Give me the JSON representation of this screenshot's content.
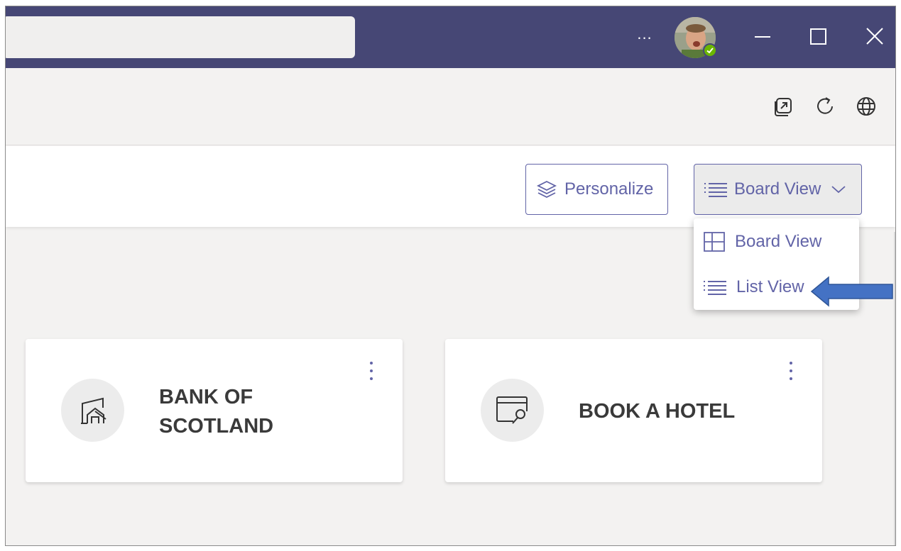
{
  "titlebar": {
    "more_label": "...",
    "avatar": "user-avatar",
    "status": "available",
    "window_buttons": [
      "minimize-icon",
      "maximize-icon",
      "close-icon"
    ]
  },
  "toolbar": {
    "icons": [
      "pop-out-icon",
      "refresh-icon",
      "globe-icon"
    ]
  },
  "header": {
    "personalize_label": "Personalize",
    "view_label": "Board View"
  },
  "dropdown": {
    "items": [
      {
        "label": "Board View",
        "icon": "board-view-icon"
      },
      {
        "label": "List View",
        "icon": "list-view-icon"
      }
    ]
  },
  "cards": [
    {
      "title_line1": "BANK OF",
      "title_line2": "SCOTLAND",
      "icon": "building-icon"
    },
    {
      "title_line1": "BOOK A HOTEL",
      "icon": "browser-search-icon"
    }
  ],
  "colors": {
    "titlebar": "#464775",
    "accent": "#6264a7",
    "status": "#6bb700",
    "arrow": "#4472c4"
  }
}
